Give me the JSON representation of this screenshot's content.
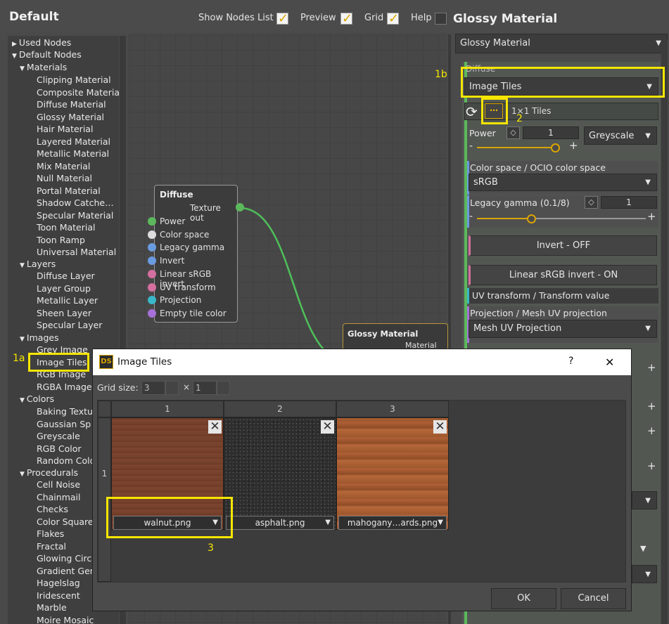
{
  "header": {
    "title": "Default",
    "show_nodes_list": "Show Nodes List",
    "preview": "Preview",
    "grid": "Grid",
    "help": "Help",
    "right_title": "Glossy Material"
  },
  "tree": {
    "used_nodes": "Used Nodes",
    "default_nodes": "Default Nodes",
    "materials": "Materials",
    "material_items": [
      "Clipping Material",
      "Composite Material",
      "Diffuse Material",
      "Glossy Material",
      "Hair Material",
      "Layered Material",
      "Metallic Material",
      "Mix Material",
      "Null Material",
      "Portal Material",
      "Shadow Catche…",
      "Specular Material",
      "Toon Material",
      "Toon Ramp",
      "Universal Material"
    ],
    "layers": "Layers",
    "layer_items": [
      "Diffuse Layer",
      "Layer Group",
      "Metallic Layer",
      "Sheen Layer",
      "Specular Layer"
    ],
    "images": "Images",
    "image_items": [
      "Grey Image",
      "Image Tiles",
      "RGB Image",
      "RGBA Image"
    ],
    "colors": "Colors",
    "color_items": [
      "Baking Textur",
      "Gaussian Sp",
      "Greyscale",
      "RGB Color",
      "Random Colo"
    ],
    "procedurals": "Procedurals",
    "procedural_items": [
      "Cell Noise",
      "Chainmail",
      "Checks",
      "Color Square",
      "Flakes",
      "Fractal",
      "Glowing Circ",
      "Gradient Gen",
      "Hagelslag",
      "Iridescent",
      "Marble",
      "Moire Mosaic"
    ]
  },
  "diffuse_node": {
    "title": "Diffuse",
    "output": "Texture out",
    "inputs": [
      "Power",
      "Color space",
      "Legacy gamma",
      "Invert",
      "Linear sRGB invert",
      "UV transform",
      "Projection",
      "Empty tile color"
    ],
    "port_colors": [
      "#5cb85c",
      "#dddddd",
      "#6a9be0",
      "#6a9be0",
      "#d46fa0",
      "#d46fa0",
      "#38b8c8",
      "#a670d8",
      "#6a9be0"
    ]
  },
  "glossy_node": {
    "title": "Glossy Material",
    "output": "Material out"
  },
  "right_panel": {
    "material_select": "Glossy Material",
    "diffuse_label": "Diffuse",
    "diffuse_select": "Image Tiles",
    "tiles_text": "1×1 Tiles",
    "power_label": "Power",
    "power_value": "1",
    "power_mode": "Greyscale",
    "power_level": 0.95,
    "color_space_label": "Color space / OCIO color space",
    "color_space_value": "sRGB",
    "legacy_gamma_label": "Legacy gamma (0.1/8)",
    "legacy_gamma_value": "1",
    "legacy_gamma_level": 0.35,
    "invert_btn": "Invert - OFF",
    "linear_btn": "Linear sRGB invert - ON",
    "uv_transform": "UV transform / Transform value",
    "projection_label": "Projection / Mesh UV projection",
    "projection_value": "Mesh UV Projection"
  },
  "dialog": {
    "title": "Image Tiles",
    "help": "?",
    "close": "✕",
    "grid_size_label": "Grid size:",
    "grid_cols": "3",
    "times": "×",
    "grid_rows": "1",
    "col_headers": [
      "1",
      "2",
      "3"
    ],
    "row_header": "1",
    "tiles": [
      "walnut.png",
      "asphalt.png",
      "mahogany…ards.png"
    ],
    "ok": "OK",
    "cancel": "Cancel"
  },
  "annotations": {
    "label_1a": "1a",
    "label_1b": "1b",
    "label_2": "2",
    "label_3": "3",
    "highlight_color": "#f6e600"
  }
}
